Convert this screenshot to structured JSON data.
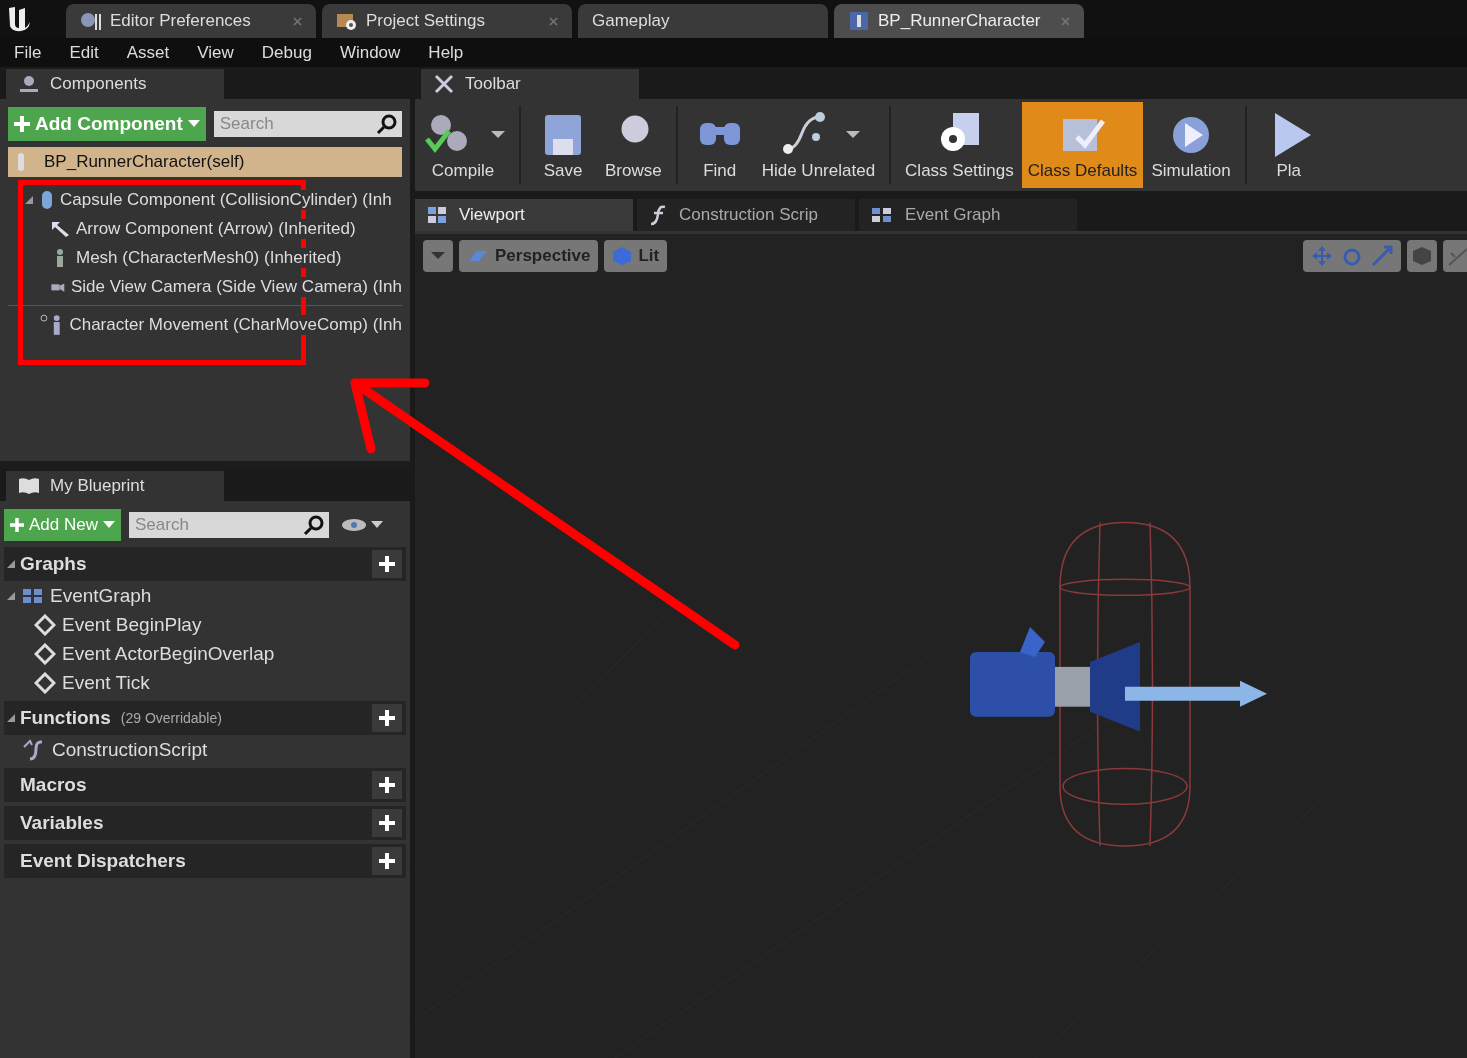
{
  "app_tabs": [
    {
      "label": "Editor Preferences",
      "kind": "prefs",
      "selected": false
    },
    {
      "label": "Project Settings",
      "kind": "settings",
      "selected": false
    },
    {
      "label": "Gameplay",
      "kind": "none",
      "selected": false
    },
    {
      "label": "BP_RunnerCharacter",
      "kind": "blueprint",
      "selected": true
    }
  ],
  "menu": [
    "File",
    "Edit",
    "Asset",
    "View",
    "Debug",
    "Window",
    "Help"
  ],
  "components_panel": {
    "title": "Components",
    "add_button": "Add Component",
    "search": {
      "placeholder": "Search"
    },
    "root": "BP_RunnerCharacter(self)",
    "tree": [
      {
        "label": "Capsule Component (CollisionCylinder) (Inh",
        "kind": "capsule",
        "expanded": true,
        "children": [
          {
            "label": "Arrow Component (Arrow) (Inherited)",
            "kind": "arrow"
          },
          {
            "label": "Mesh (CharacterMesh0) (Inherited)",
            "kind": "mesh"
          },
          {
            "label": "Side View Camera (Side View Camera) (Inh",
            "kind": "camera"
          }
        ]
      },
      {
        "label": "Character Movement (CharMoveComp) (Inh",
        "kind": "movement"
      }
    ]
  },
  "toolbar": {
    "title": "Toolbar",
    "buttons": [
      {
        "label": "Compile",
        "kind": "compile",
        "dropdown": true,
        "selected": false
      },
      {
        "label": "Save",
        "kind": "save",
        "dropdown": false,
        "selected": false
      },
      {
        "label": "Browse",
        "kind": "browse",
        "dropdown": false,
        "selected": false
      },
      {
        "label": "Find",
        "kind": "find",
        "dropdown": false,
        "selected": false
      },
      {
        "label": "Hide Unrelated",
        "kind": "hide",
        "dropdown": true,
        "selected": false
      },
      {
        "label": "Class Settings",
        "kind": "classsettings",
        "dropdown": false,
        "selected": false
      },
      {
        "label": "Class Defaults",
        "kind": "classdefaults",
        "dropdown": false,
        "selected": true
      },
      {
        "label": "Simulation",
        "kind": "simulation",
        "dropdown": false,
        "selected": false
      },
      {
        "label": "Pla",
        "kind": "play",
        "dropdown": false,
        "selected": false
      }
    ]
  },
  "editor_tabs": [
    {
      "label": "Viewport",
      "kind": "viewport",
      "selected": true
    },
    {
      "label": "Construction Scrip",
      "kind": "function",
      "selected": false
    },
    {
      "label": "Event Graph",
      "kind": "graph",
      "selected": false
    }
  ],
  "viewport": {
    "view_mode": "Perspective",
    "lighting": "Lit"
  },
  "my_blueprint": {
    "title": "My Blueprint",
    "add_button": "Add New",
    "search": {
      "placeholder": "Search"
    },
    "sections": [
      {
        "title": "Graphs",
        "expanded": true,
        "items": [
          {
            "label": "EventGraph",
            "kind": "graph",
            "expanded": true,
            "children": [
              {
                "label": "Event BeginPlay",
                "kind": "event"
              },
              {
                "label": "Event ActorBeginOverlap",
                "kind": "event"
              },
              {
                "label": "Event Tick",
                "kind": "event"
              }
            ]
          }
        ]
      },
      {
        "title": "Functions",
        "note": "(29 Overridable)",
        "expanded": true,
        "items": [
          {
            "label": "ConstructionScript",
            "kind": "function"
          }
        ]
      },
      {
        "title": "Macros",
        "expanded": false
      },
      {
        "title": "Variables",
        "expanded": false
      },
      {
        "title": "Event Dispatchers",
        "expanded": false
      }
    ]
  }
}
